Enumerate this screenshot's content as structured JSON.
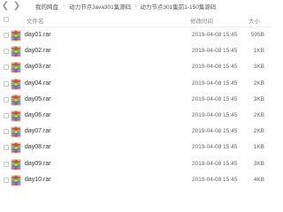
{
  "toolbar": {
    "back_icon": "chevron-left-icon",
    "forward_icon": "chevron-right-icon",
    "breadcrumb": [
      "我的网盘",
      "动力节点Java301集源码",
      "动力节点301集前1-150集源码"
    ]
  },
  "header": {
    "name": "文件名",
    "date": "修改时间",
    "size": "大小"
  },
  "files": [
    {
      "name": "day01.rar",
      "date": "2019-04-08 15:45",
      "size": "595B",
      "icon": "rar-archive-icon"
    },
    {
      "name": "day02.rar",
      "date": "2019-04-08 15:45",
      "size": "1KB",
      "icon": "rar-archive-icon"
    },
    {
      "name": "day03.rar",
      "date": "2019-04-08 15:45",
      "size": "3KB",
      "icon": "rar-archive-icon"
    },
    {
      "name": "day04.rar",
      "date": "2019-04-08 15:45",
      "size": "2KB",
      "icon": "rar-archive-icon"
    },
    {
      "name": "day05.rar",
      "date": "2019-04-08 15:45",
      "size": "3KB",
      "icon": "rar-archive-icon"
    },
    {
      "name": "day06.rar",
      "date": "2019-04-08 15:45",
      "size": "2KB",
      "icon": "rar-archive-icon"
    },
    {
      "name": "day07.rar",
      "date": "2019-04-08 15:45",
      "size": "2KB",
      "icon": "rar-archive-icon"
    },
    {
      "name": "day08.rar",
      "date": "2019-04-08 15:45",
      "size": "1KB",
      "icon": "rar-archive-icon"
    },
    {
      "name": "day09.rar",
      "date": "2019-04-08 15:45",
      "size": "3KB",
      "icon": "rar-archive-icon"
    },
    {
      "name": "day10.rar",
      "date": "2019-04-08 15:45",
      "size": "4KB",
      "icon": "rar-archive-icon"
    }
  ]
}
